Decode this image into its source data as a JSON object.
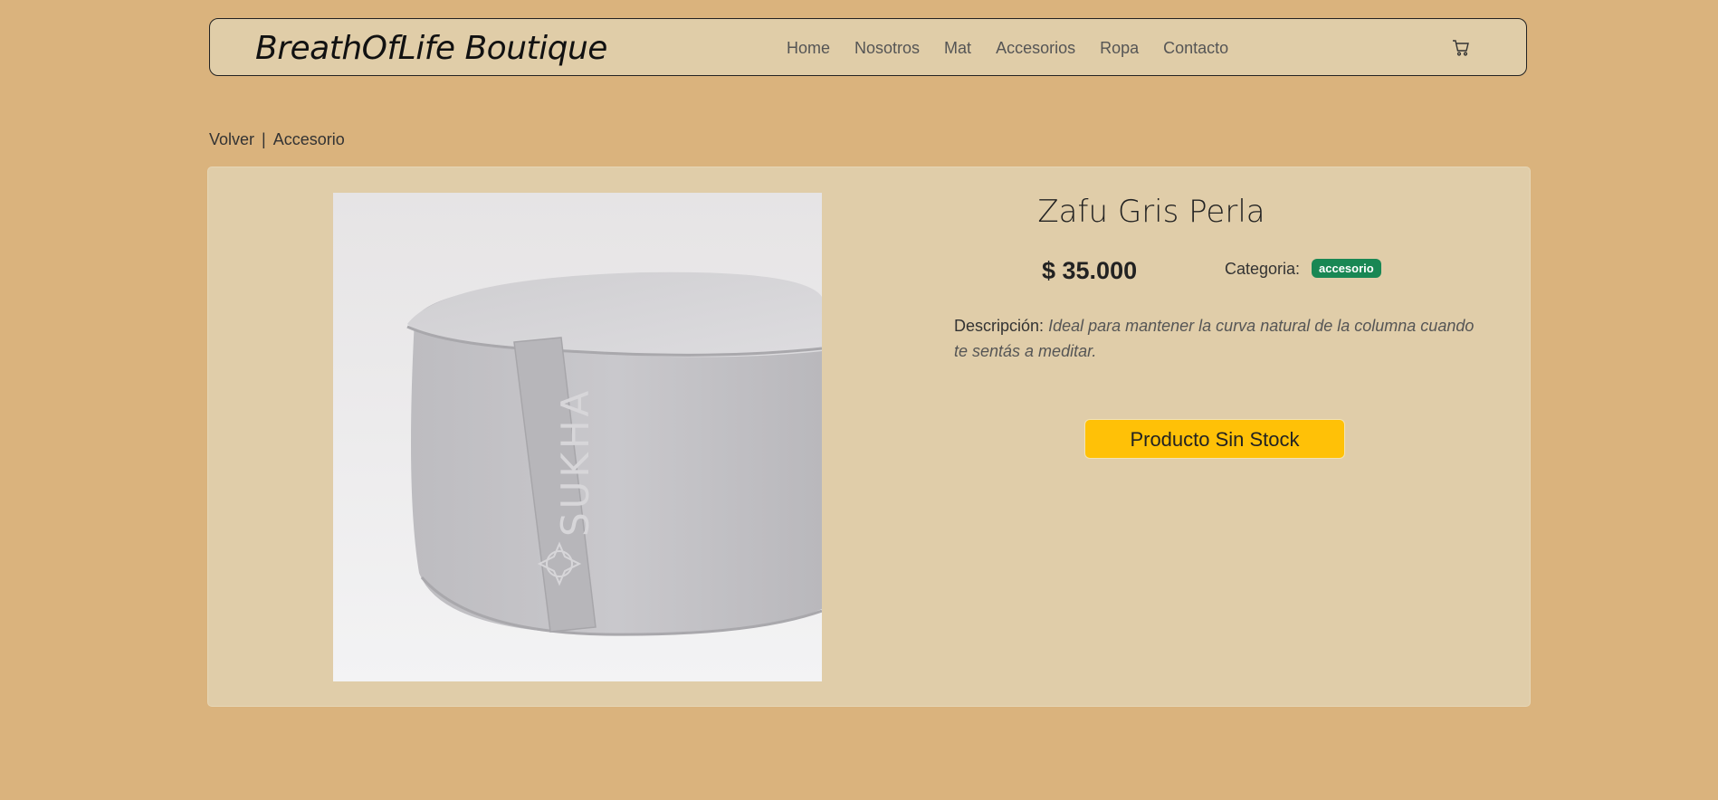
{
  "header": {
    "brand": "BreathOfLife Boutique",
    "nav": [
      "Home",
      "Nosotros",
      "Mat",
      "Accesorios",
      "Ropa",
      "Contacto"
    ],
    "cart_icon": "cart-icon"
  },
  "breadcrumb": {
    "back": "Volver",
    "separator": "|",
    "current": "Accesorio"
  },
  "product": {
    "name": "Zafu Gris Perla",
    "price": "$ 35.000",
    "category_label": "Categoria:",
    "category": "accesorio",
    "description_label": "Descripción:",
    "description": "Ideal para mantener la curva natural de la columna cuando te sentás a meditar.",
    "image_text": "SUKHA",
    "stock_button": "Producto Sin Stock"
  },
  "colors": {
    "background": "#dab37d",
    "panel": "#e0cda9",
    "badge": "#198754",
    "button": "#ffc107"
  }
}
